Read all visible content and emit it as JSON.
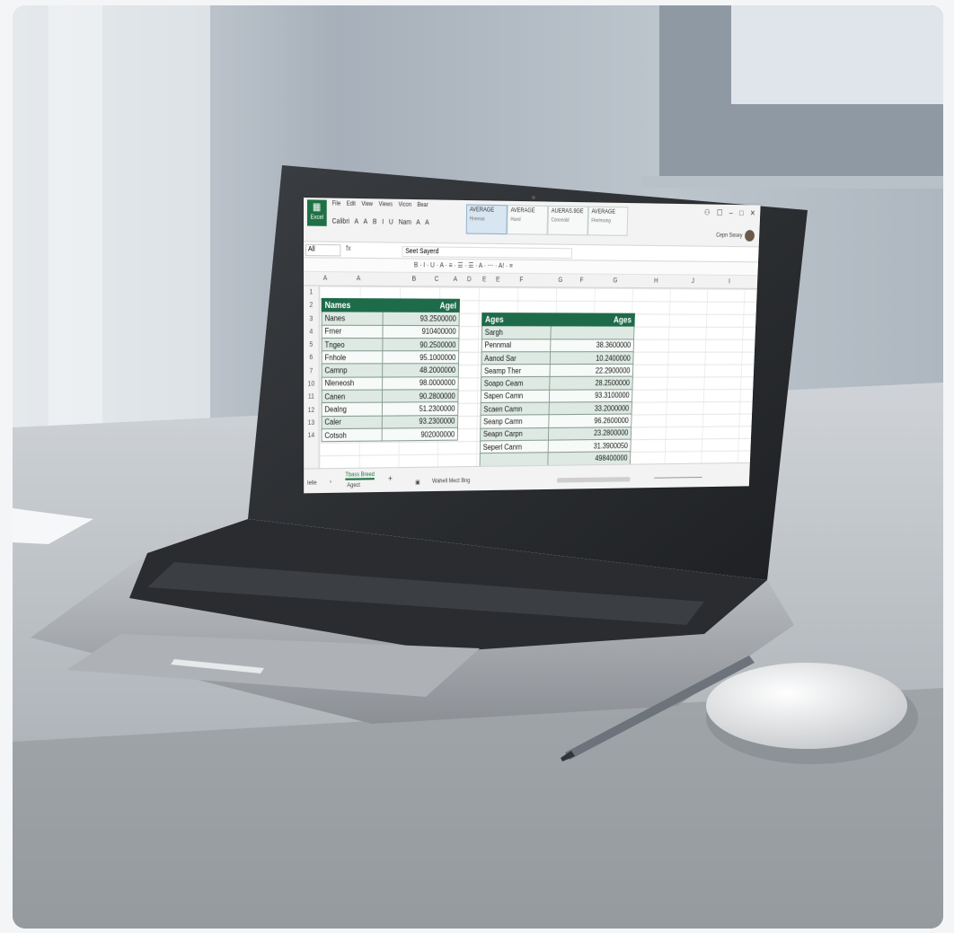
{
  "app": {
    "logo_text": "Excel",
    "menu": [
      "File",
      "Edit",
      "View",
      "Views",
      "Vicon",
      "Bear"
    ],
    "toolbar_tools": [
      "Calibri",
      "A",
      "A",
      "B",
      "I",
      "U",
      "Nam",
      "A",
      "A"
    ],
    "style_gallery": [
      {
        "title": "AVERAGE",
        "sub": "Hneeaa"
      },
      {
        "title": "AVERAGE",
        "sub": "Hued"
      },
      {
        "title": "AUERAS.9GE",
        "sub": "Conoeald"
      },
      {
        "title": "AVERAGE",
        "sub": "Fferlmsing"
      }
    ],
    "window_controls": [
      "⚇",
      "☐",
      "–",
      "□",
      "✕"
    ],
    "user_name": "Cepn Sesey"
  },
  "formula_bar": {
    "name_box": "All",
    "fx": "fx",
    "value": "Seet Sayerd"
  },
  "format_row": "B · I · U · A · ≡ · ☰ · ☰ · A · ⋯ · A! · ≡",
  "columns": [
    "A",
    "A",
    "B",
    "C",
    "A",
    "D",
    "E",
    "E",
    "F",
    "G",
    "F",
    "G",
    "H",
    "J",
    "I"
  ],
  "rows": [
    "1",
    "2",
    "3",
    "4",
    "5",
    "6",
    "7",
    "10",
    "11",
    "12",
    "13",
    "14"
  ],
  "names_table": {
    "header_left": "Names",
    "header_right": "Agel",
    "rows": [
      [
        "Nanes",
        "93.2500000"
      ],
      [
        "Frner",
        "910400000"
      ],
      [
        "Tngeo",
        "90.2500000"
      ],
      [
        "Fnhole",
        "95.1000000"
      ],
      [
        "Camnp",
        "48.2000000"
      ],
      [
        "Nleneosh",
        "98.0000000"
      ],
      [
        "Canen",
        "90.2800000"
      ],
      [
        "Dealng",
        "51.2300000"
      ],
      [
        "Caler",
        "93.2300000"
      ],
      [
        "Cotsoh",
        "902000000"
      ]
    ]
  },
  "ages_table": {
    "header_left": "Ages",
    "header_right": "Ages",
    "rows": [
      [
        "Sargh",
        ""
      ],
      [
        "Pennmal",
        "38.3600000"
      ],
      [
        "Aanod Sar",
        "10.2400000"
      ],
      [
        "Seamp Ther",
        "22.2900000"
      ],
      [
        "Soapo Ceam",
        "28.2500000"
      ],
      [
        "Sapen Camn",
        "93.3100000"
      ],
      [
        "Scaen Camn",
        "33.2000000"
      ],
      [
        "Seanp Camn",
        "96.2600000"
      ],
      [
        "Seapn Carpn",
        "23.2800000"
      ],
      [
        "Seperl Canm",
        "31.3900050"
      ],
      [
        "",
        "498400000"
      ]
    ]
  },
  "sheet_bar": {
    "left_label": "Ielle",
    "tab_active": "Tbass Breed",
    "tab_second": "Agect",
    "status_text": "Wahell Mect Bng",
    "add_symbol": "+"
  },
  "colors": {
    "excel_green": "#1e7145",
    "table_header": "#1e6b4a",
    "row_alt": "#dde9e2"
  }
}
